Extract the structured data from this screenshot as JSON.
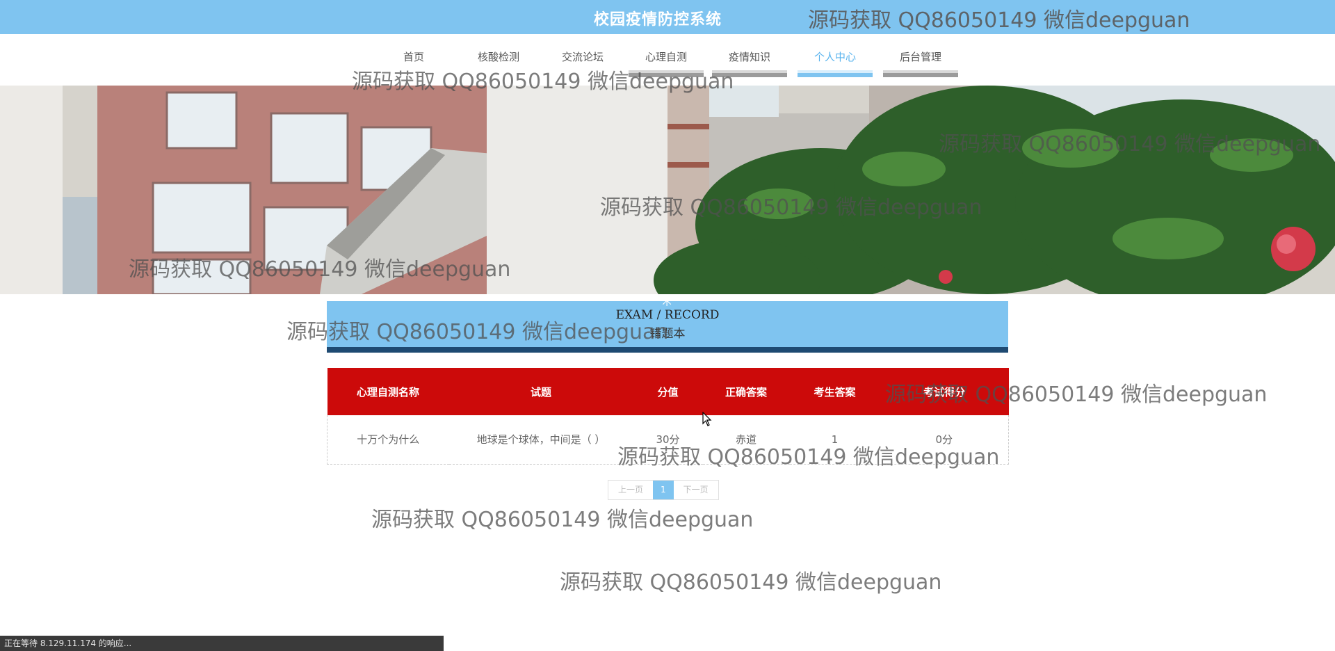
{
  "header": {
    "title": "校园疫情防控系统"
  },
  "nav": {
    "items": [
      {
        "label": "首页"
      },
      {
        "label": "核酸检测"
      },
      {
        "label": "交流论坛"
      },
      {
        "label": "心理自测"
      },
      {
        "label": "疫情知识"
      },
      {
        "label": "个人中心",
        "active": true
      },
      {
        "label": "后台管理"
      }
    ]
  },
  "section": {
    "title_en": "EXAM / RECORD",
    "title_cn": "错题本",
    "icon": "star-icon"
  },
  "table": {
    "headers": [
      "心理自测名称",
      "试题",
      "分值",
      "正确答案",
      "考生答案",
      "考试得分"
    ],
    "rows": [
      [
        "十万个为什么",
        "地球是个球体，中间是（ ）",
        "30分",
        "赤道",
        "1",
        "0分"
      ]
    ]
  },
  "pagination": {
    "prev": "上一页",
    "current": "1",
    "next": "下一页"
  },
  "watermark": "源码获取 QQ86050149 微信deepguan",
  "statusbar": {
    "text": "正在等待 8.129.11.174 的响应..."
  },
  "colors": {
    "topbar": "#7fc4f0",
    "table_header": "#cc0a0a",
    "section_bar": "#1e4a72",
    "active_nav": "#5ab4ee"
  }
}
